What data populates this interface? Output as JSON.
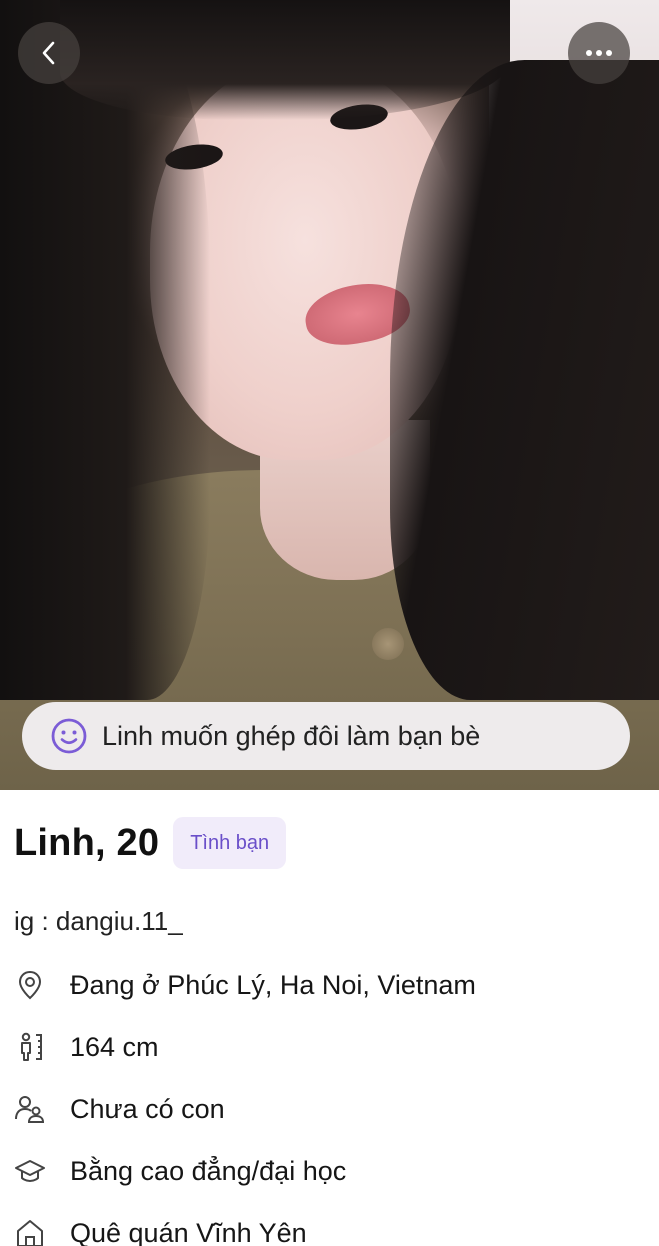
{
  "photo": {
    "alt": ""
  },
  "header": {
    "back_icon": "chevron-left-icon",
    "more_icon": "more-horizontal-icon"
  },
  "match_banner": {
    "text": "Linh muốn ghép đôi làm bạn bè",
    "icon": "smile-icon",
    "accent": "#7b5cd6"
  },
  "profile": {
    "name_age": "Linh, 20",
    "tag": "Tình bạn",
    "bio": "ig : dangiu.11_",
    "attributes": [
      {
        "icon": "location-pin-icon",
        "text": "Đang ở Phúc Lý, Ha Noi, Vietnam"
      },
      {
        "icon": "height-icon",
        "text": "164 cm"
      },
      {
        "icon": "children-icon",
        "text": "Chưa có con"
      },
      {
        "icon": "education-icon",
        "text": "Bằng cao đẳng/đại học"
      },
      {
        "icon": "home-icon",
        "text": "Quê quán Vĩnh Yên"
      }
    ]
  },
  "colors": {
    "tag_bg": "#f1ecfa",
    "tag_text": "#6a4fc9"
  }
}
